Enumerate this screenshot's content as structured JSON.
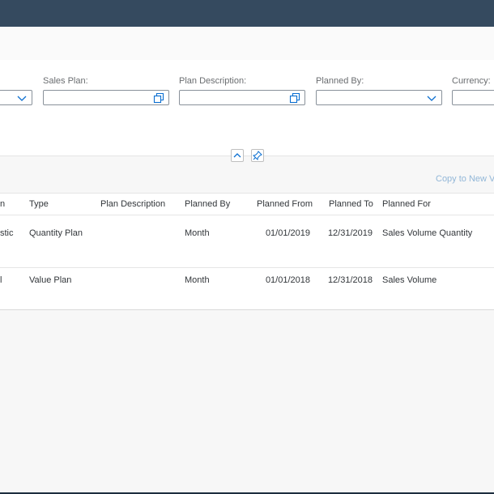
{
  "filters": {
    "sales_plan_label": "Sales Plan:",
    "plan_description_label": "Plan Description:",
    "planned_by_label": "Planned By:",
    "currency_label": "Currency:"
  },
  "toolbar": {
    "copy_link": "Copy to New Ve"
  },
  "table": {
    "columns": [
      "n",
      "Type",
      "Plan Description",
      "Planned By",
      "Planned From",
      "Planned To",
      "Planned For"
    ],
    "rows": [
      {
        "name_fragment": "stic",
        "type": "Quantity Plan",
        "plan_description": "",
        "planned_by": "Month",
        "planned_from": "01/01/2019",
        "planned_to": "12/31/2019",
        "planned_for": "Sales Volume Quantity"
      },
      {
        "name_fragment": "l",
        "type": "Value Plan",
        "plan_description": "",
        "planned_by": "Month",
        "planned_from": "01/01/2018",
        "planned_to": "12/31/2018",
        "planned_for": "Sales Volume"
      }
    ]
  },
  "icons": {
    "value_help": "value-help-icon",
    "dropdown": "chevron-down-icon",
    "collapse": "chevron-up-icon",
    "pin": "pin-icon"
  },
  "colors": {
    "shellbar": "#354a5f",
    "link": "#92b7d8",
    "icon": "#0a6ed1"
  }
}
